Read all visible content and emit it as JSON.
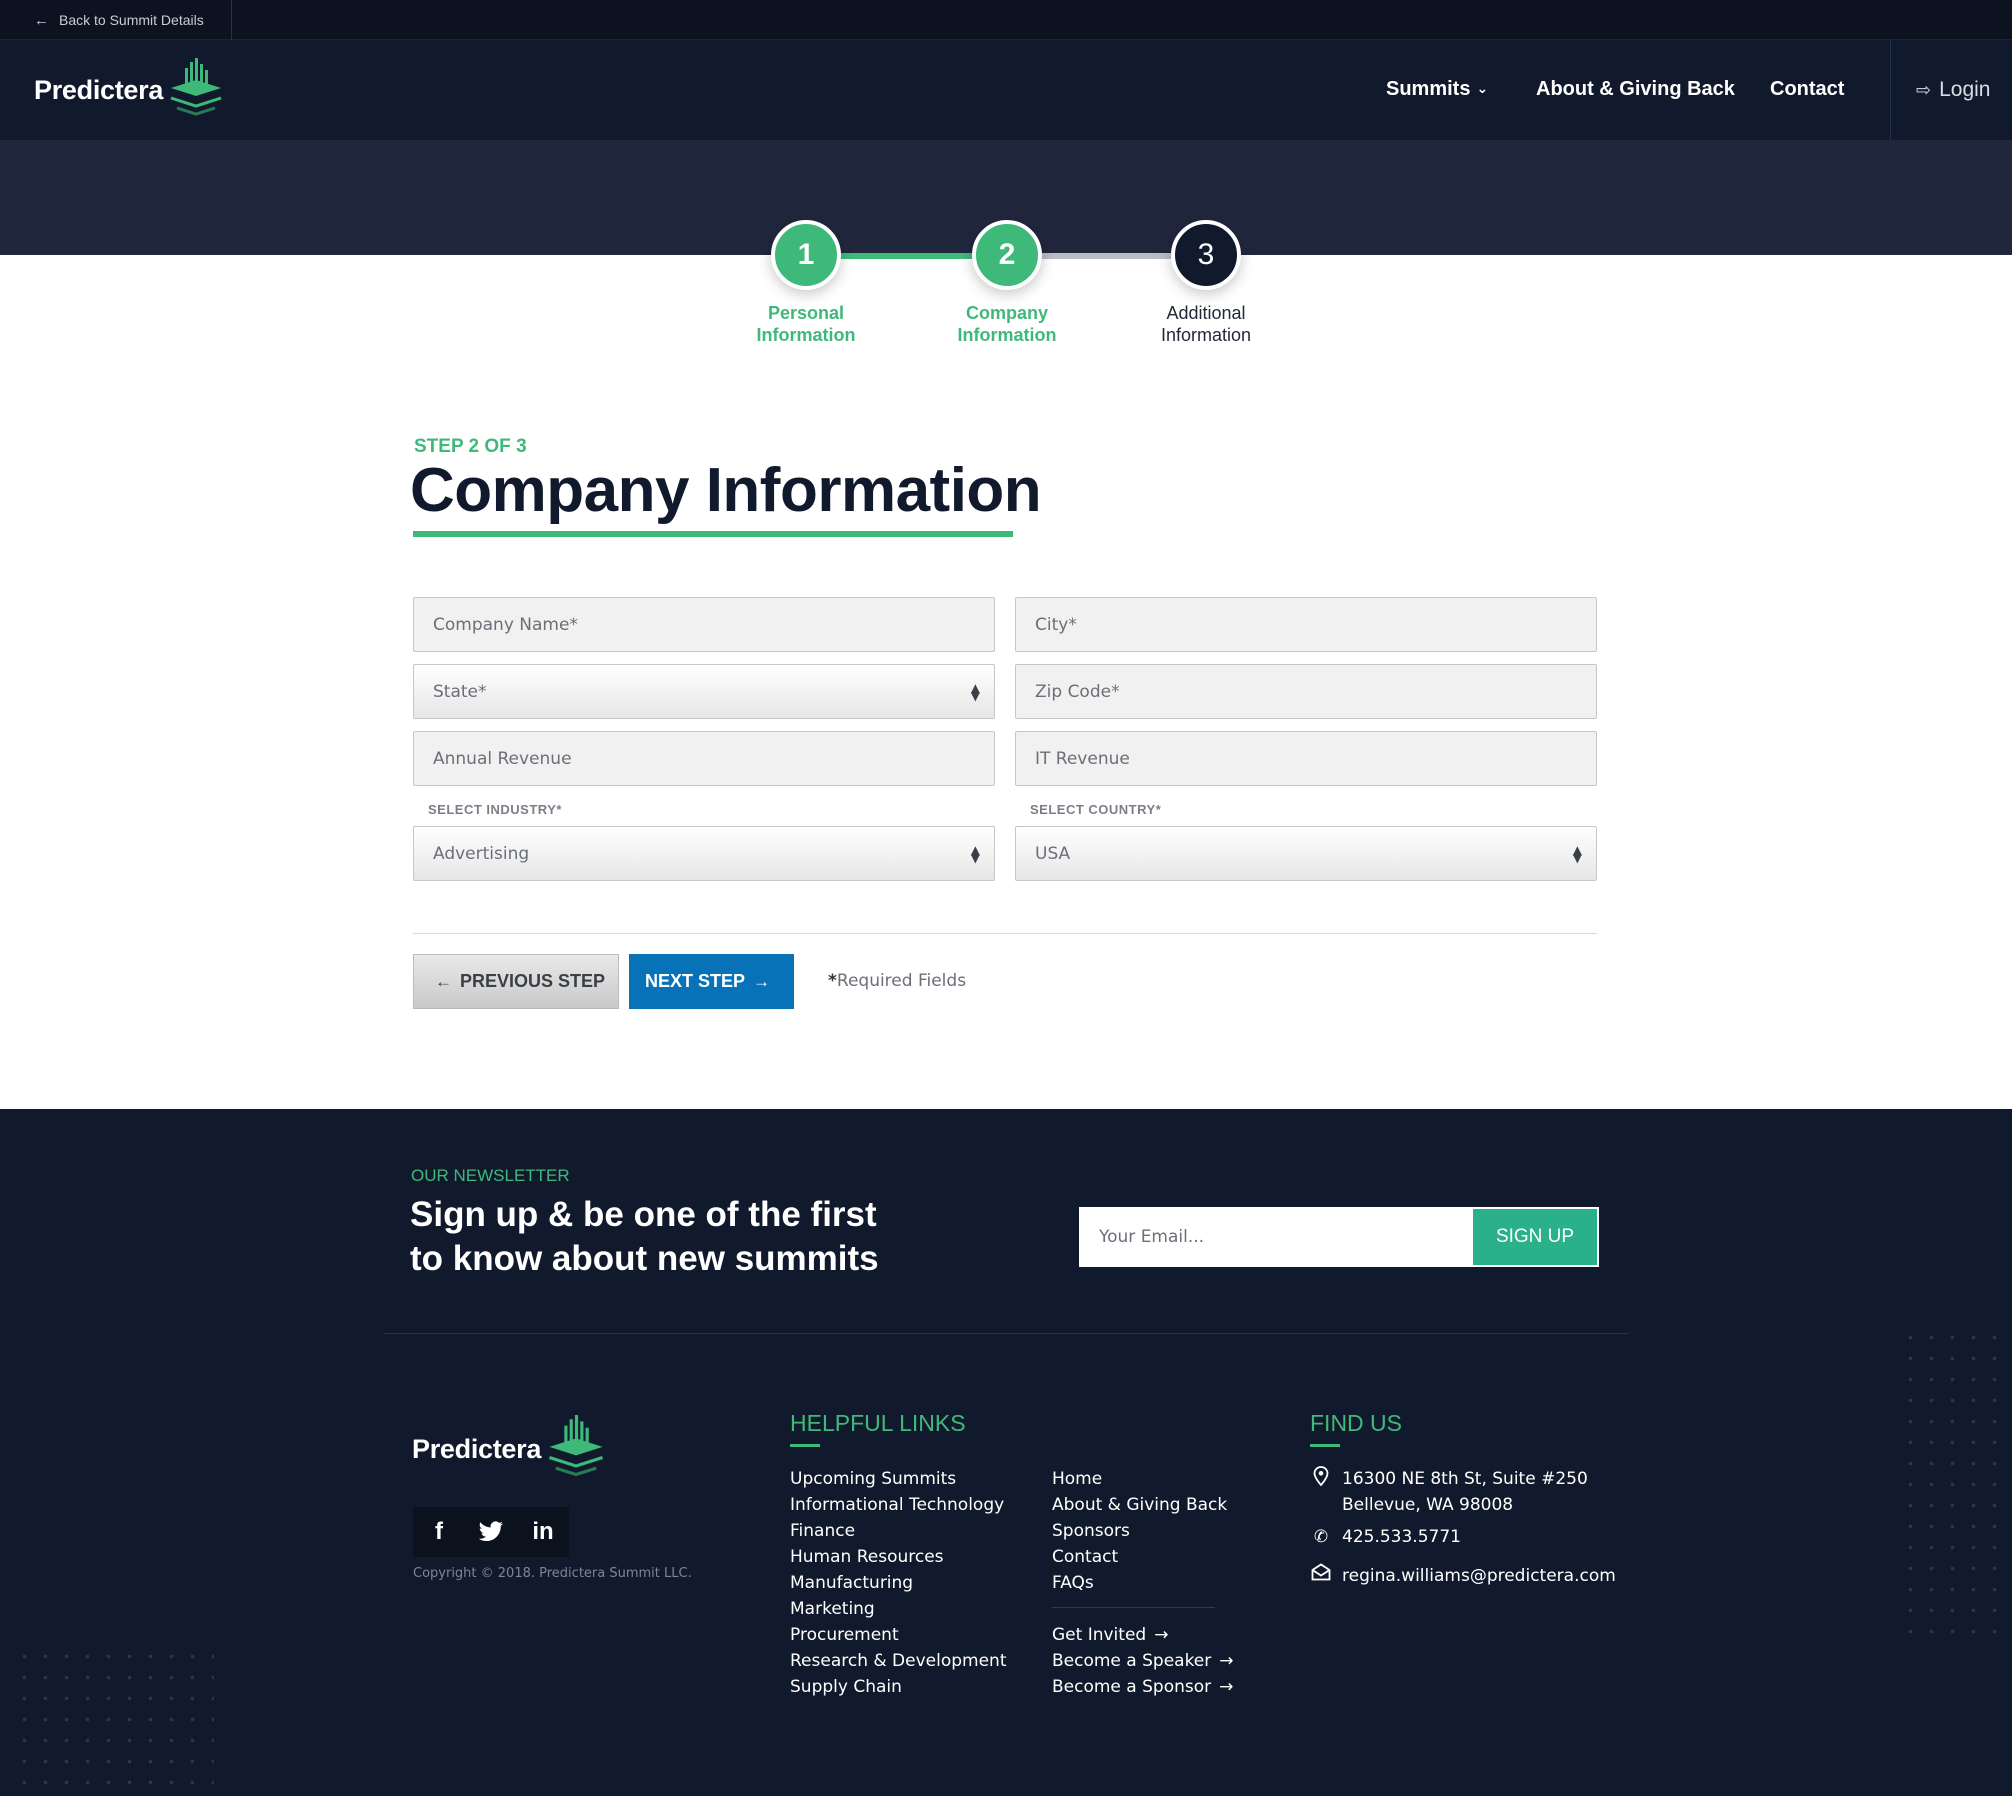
{
  "topbar": {
    "back_label": "Back to Summit Details"
  },
  "brand": {
    "name": "Predictera",
    "primary_color": "#3fb97a",
    "nav_bg": "#111a2c",
    "button_blue": "#0772b8"
  },
  "nav": {
    "items": [
      "Summits",
      "About & Giving Back",
      "Contact"
    ],
    "login_label": "Login"
  },
  "stepper": {
    "steps": [
      {
        "number": "1",
        "line1": "Personal",
        "line2": "Information",
        "state": "complete"
      },
      {
        "number": "2",
        "line1": "Company",
        "line2": "Information",
        "state": "current"
      },
      {
        "number": "3",
        "line1": "Additional",
        "line2": "Information",
        "state": "upcoming"
      }
    ]
  },
  "form": {
    "step_label": "STEP 2 OF 3",
    "title": "Company Information",
    "fields": {
      "company_name": "Company Name*",
      "city": "City*",
      "state": "State*",
      "zip": "Zip Code*",
      "annual_revenue": "Annual Revenue",
      "it_revenue": "IT Revenue",
      "industry_label": "SELECT INDUSTRY*",
      "industry_value": "Advertising",
      "country_label": "SELECT COUNTRY*",
      "country_value": "USA"
    },
    "prev_label": "PREVIOUS STEP",
    "next_label": "NEXT STEP",
    "required_mark": "*",
    "required_text": "Required Fields"
  },
  "newsletter": {
    "eyebrow": "OUR NEWSLETTER",
    "title_line1": "Sign up & be one of the first",
    "title_line2": "to know about new summits",
    "email_placeholder": "Your Email...",
    "button_label": "SIGN UP"
  },
  "footer": {
    "brand": "Predictera",
    "social_icons": [
      "facebook-icon",
      "twitter-icon",
      "linkedin-icon"
    ],
    "copyright": "Copyright © 2018. Predictera Summit LLC.",
    "helpful_links_heading": "HELPFUL LINKS",
    "links_col1": [
      "Upcoming Summits",
      "Informational Technology",
      "Finance",
      "Human Resources",
      "Manufacturing",
      "Marketing",
      "Procurement",
      "Research & Development",
      "Supply Chain"
    ],
    "links_col2": [
      "Home",
      "About & Giving Back",
      "Sponsors",
      "Contact",
      "FAQs"
    ],
    "links_col3": [
      "Get Invited",
      "Become a Speaker",
      "Become a Sponsor"
    ],
    "find_us_heading": "FIND US",
    "address_line1": "16300 NE 8th St, Suite #250",
    "address_line2": "Bellevue, WA 98008",
    "phone": "425.533.5771",
    "email": "regina.williams@predictera.com"
  }
}
